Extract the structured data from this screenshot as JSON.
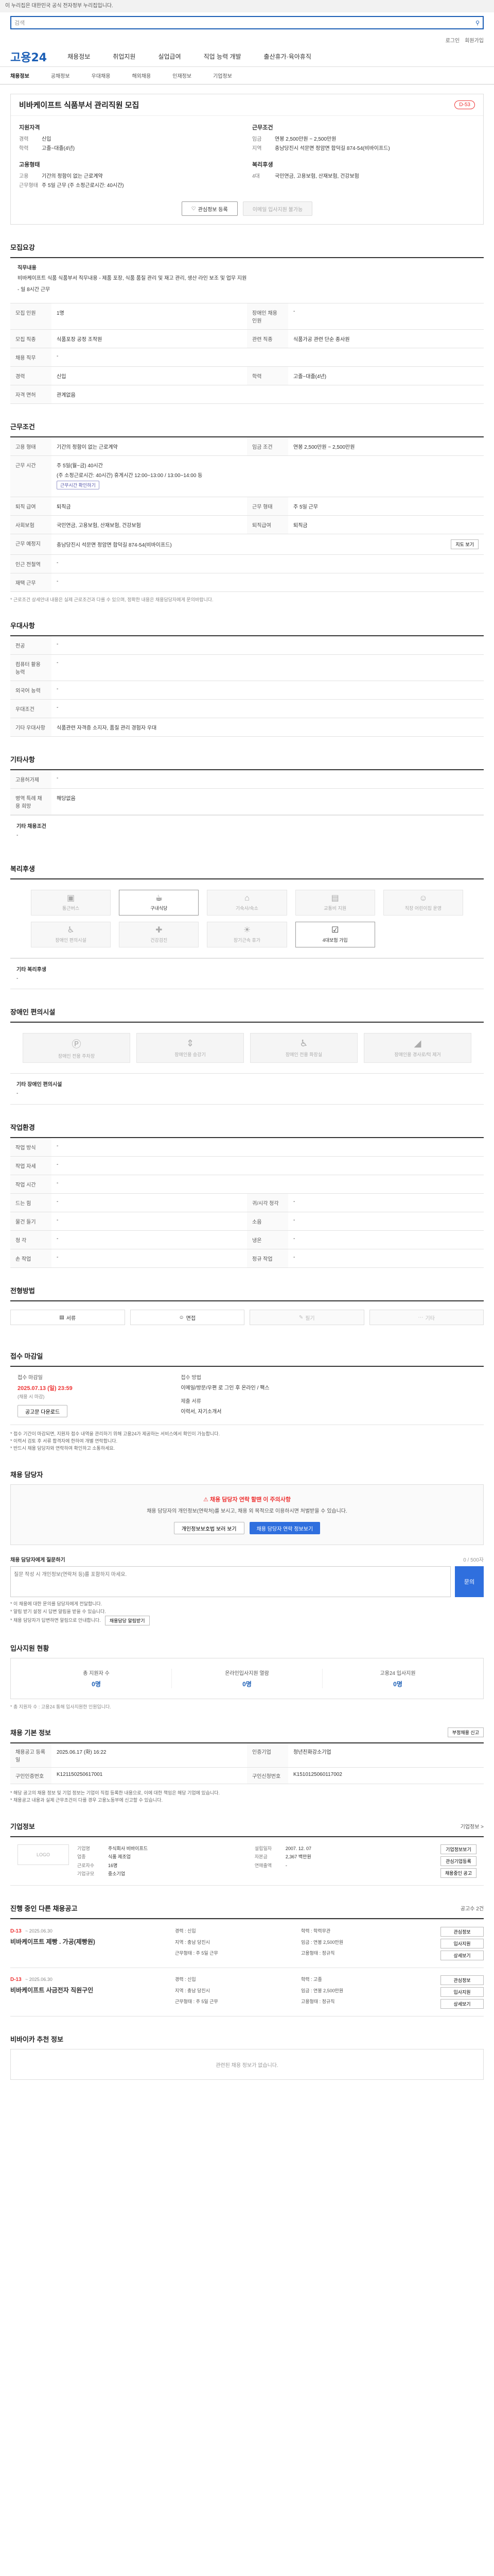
{
  "gov_bar": "이 누리집은 대한민국 공식 전자정부 누리집입니다.",
  "search": {
    "placeholder": "검색"
  },
  "util": [
    "로그인",
    "회원가입"
  ],
  "logo": "고용24",
  "gnb": [
    "채용정보",
    "취업지원",
    "실업급여",
    "직업 능력 개발",
    "출산휴가·육아휴직"
  ],
  "lnb": [
    "채용정보",
    "공채정보",
    "우대채용",
    "해외채용",
    "인재정보",
    "기업정보"
  ],
  "job": {
    "title": "비바케이프트 식품부서 관리직원 모집",
    "badge": "D-53",
    "company_label": "지원자격",
    "apply_label": "근무조건",
    "left": [
      {
        "k": "경력",
        "v": "신입"
      },
      {
        "k": "학력",
        "v": "고졸~대졸(4년)"
      }
    ],
    "right": [
      {
        "k": "임금",
        "v": "연봉 2,500만원 ~ 2,500만원"
      },
      {
        "k": "지역",
        "v": "충남당진시 석문면 정암면 합덕길 874-54(비바이프드)"
      }
    ],
    "left2_label": "고용형태",
    "left2": [
      {
        "k": "고용",
        "v": "기간의 정함이 없는 근로계약"
      },
      {
        "k": "근무형태",
        "v": "주 5일 근무 (주 소정근로시간: 40시간)"
      }
    ],
    "right2_label": "복리후생",
    "right2": [
      {
        "k": "4대",
        "v": "국민연금, 고용보험, 산재보험, 건강보험"
      }
    ],
    "btn_scrap": "관심정보 등록",
    "btn_apply": "이메일 입사지원 불가능"
  },
  "recruit": {
    "title": "모집요강",
    "desc_label": "직무내용",
    "desc": "비바케이프트 식품 식품부서 직무내용 - 제품 포장, 식품 품질 관리 및 재고 관리, 생산 라인 보조 및 업무 지원",
    "desc_extra": "- 일 8시간 근무",
    "rows": [
      {
        "k": "모집 인원",
        "v": "1명",
        "k2": "장애인 채용 인원",
        "v2": "-"
      },
      {
        "k": "모집 직종",
        "v": "식품포장 공정 조작원",
        "k2": "관련 직종",
        "v2": "식품가공 관련 단순 종사원"
      },
      {
        "k": "채용 직무",
        "v": "-",
        "k2": "",
        "v2": ""
      },
      {
        "k": "경력",
        "v": "신입",
        "k2": "학력",
        "v2": "고졸~대졸(4년)"
      },
      {
        "k": "자격 면허",
        "v": "관계없음",
        "k2": "",
        "v2": ""
      }
    ]
  },
  "conditions": {
    "title": "근무조건",
    "rows": [
      {
        "k": "고용 형태",
        "v": "기간의 정함이 없는 근로계약",
        "k2": "임금 조건",
        "v2": "연봉 2,500만원 ~ 2,500만원"
      },
      {
        "k": "",
        "v": "주 5일(월~금) 40시간",
        "k2": "",
        "v2": ""
      },
      {
        "k": "근무 시간",
        "v": "(주 소정근로시간: 40시간) 휴게시간 12:00~13:00 / 13:00~14:00 등",
        "k2": "",
        "v2": ""
      },
      {
        "k": "퇴직 급여",
        "v": "퇴직금",
        "k2": "근무 형태",
        "v2": "주 5일 근무"
      },
      {
        "k": "사회보험",
        "v": "국민연금, 고용보험, 산재보험, 건강보험",
        "k2": "퇴직급여",
        "v2": "퇴직금"
      },
      {
        "k": "근무 예정지",
        "v": "충남당진시 석문면 정암면 합덕길 874-54(비바이프드)",
        "k2": "",
        "v2": ""
      },
      {
        "k": "인근 전철역",
        "v": "-",
        "k2": "",
        "v2": ""
      },
      {
        "k": "재택 근무",
        "v": "-",
        "k2": "",
        "v2": ""
      }
    ],
    "map_btn": "지도 보기",
    "worktime_chip": "근무시간 확인하기",
    "note": "* 근로조건 상세안내 내용은 실제 근로조건과 다를 수 있으며, 정확한 내용은 채용담당자에게 문의바랍니다."
  },
  "preference": {
    "title": "우대사항",
    "rows": [
      {
        "k": "전공",
        "v": "-"
      },
      {
        "k": "컴퓨터 활용 능력",
        "v": "-"
      },
      {
        "k": "외국어 능력",
        "v": "-"
      },
      {
        "k": "우대조건",
        "v": "-"
      },
      {
        "k": "기타 우대사항",
        "v": "식품관련 자격증 소지자, 품질 관리 경험자 우대"
      }
    ]
  },
  "etc": {
    "title": "기타사항",
    "rows": [
      {
        "k": "고용허가제",
        "v": "-"
      },
      {
        "k": "병역 특례 채용 희망",
        "v": "해당없음"
      }
    ],
    "extra_label": "기타 채용조건",
    "extra_value": "-"
  },
  "welfare": {
    "title": "복리후생",
    "items": [
      {
        "icon": "home-icon",
        "label": "통근버스",
        "on": false
      },
      {
        "icon": "meal-icon",
        "label": "구내식당",
        "on": true
      },
      {
        "icon": "dorm-icon",
        "label": "기숙사/숙소",
        "on": false
      },
      {
        "icon": "car-icon",
        "label": "교통비 지원",
        "on": false
      },
      {
        "icon": "childcare-icon",
        "label": "직장 어린이집 운영",
        "on": false
      },
      {
        "icon": "support-icon",
        "label": "장애인 편의시설",
        "on": false
      },
      {
        "icon": "health-icon",
        "label": "건강검진",
        "on": false
      },
      {
        "icon": "vacation-icon",
        "label": "장기근속 휴가",
        "on": false
      },
      {
        "icon": "insurance-icon",
        "label": "4대보험 가입",
        "on": true
      }
    ],
    "extra_label": "기타 복리후생",
    "extra_value": "-"
  },
  "disability": {
    "title": "장애인 편의시설",
    "items": [
      "장애인 전용 주차장",
      "장애인용 승강기",
      "장애인 전용 화장실",
      "장애인용 경사로/턱 제거"
    ],
    "extra_label": "기타 장애인 편의시설",
    "extra_value": "-"
  },
  "work_env": {
    "title": "작업환경",
    "rows": [
      {
        "k": "작업 방식",
        "v": "-",
        "k2": "",
        "v2": ""
      },
      {
        "k": "작업 자세",
        "v": "-",
        "k2": "",
        "v2": ""
      },
      {
        "k": "작업 시간",
        "v": "-",
        "k2": "",
        "v2": ""
      },
      {
        "k": "드는 힘",
        "v": "-",
        "k2": "귀/시각 청각",
        "v2": "-"
      },
      {
        "k": "물건 들기",
        "v": "-",
        "k2": "소음",
        "v2": "-"
      },
      {
        "k": "청 각",
        "v": "-",
        "k2": "냉온",
        "v2": "-"
      },
      {
        "k": "손 작업",
        "v": "-",
        "k2": "정규 작업",
        "v2": "-"
      }
    ]
  },
  "method": {
    "title": "전형방법",
    "items": [
      {
        "icon": "doc-icon",
        "label": "서류",
        "off": false
      },
      {
        "icon": "interview-icon",
        "label": "면접",
        "off": false
      },
      {
        "icon": "test-icon",
        "label": "필기",
        "off": true
      },
      {
        "icon": "etc-icon",
        "label": "기타",
        "off": true
      }
    ]
  },
  "apply": {
    "title": "접수 마감일",
    "deadline_label": "접수 마감일",
    "deadline": "2025.07.13 (일) 23:59",
    "deadline_note": "(채용 시 마감)",
    "posting_btn": "공고문 다운로드",
    "method_label": "접수 방법",
    "method": "이메일/방문/우편 로 그인 후 온라인 / 팩스",
    "doc_label": "제출 서류",
    "doc": "이력서, 자기소개서",
    "notes": [
      "* 접수 기간이 마감되면, 지원자 접수 내역을 관리하기 위해 고용24가 제공하는 서비스에서 확인이 가능합니다.",
      "* 이력서 검토 후 서류 합격자에 한하여 개별 연락합니다.",
      "* 반드시 채용 담당자와 연락하여 확인하고 소통하세요."
    ]
  },
  "contact": {
    "title": "채용 담당자",
    "warn_title": "채용 담당자 연락 할땐 이 주의사항",
    "warn_text": "채용 담당자의 개인정보(연락처)를 보시고, 채용 외 목적으로 이용하시면 처벌받을 수 있습니다.",
    "btn_person": "개인정보보호법 보러 보기",
    "btn_contact": "채용 담당자 연락 정보보기",
    "inquiry_label": "채용 담당자에게 질문하기",
    "inquiry_count": "0 / 500자",
    "inquiry_placeholder": "질문 작성 시 개인정보(연락처 등)를 포함하지 마세요.",
    "send": "문의",
    "inq_notes": [
      "* 이 채용에 대한 문의를 담당자에게 전달합니다.",
      "* 알림 받기 설정 시 답변 알림을 받을 수 있습니다.",
      "* 채용 담당자가 답변하면 알림으로 안내합니다."
    ],
    "notify_btn": "채용담당 알림받기"
  },
  "status": {
    "title": "입사지원 현황",
    "items": [
      {
        "k": "총 지원자 수",
        "v": "0명"
      },
      {
        "k": "온라인입사지원 열람",
        "v": "0명"
      },
      {
        "k": "고용24 입사지원",
        "v": "0명"
      }
    ],
    "note": "* 총 지원자 수 : 고용24 통해 입사지원한 인원입니다."
  },
  "info": {
    "title": "채용 기본 정보",
    "rows": [
      {
        "k": "채용공고 등록일",
        "v": "2025.06.17 (화) 16:22",
        "k2": "인증기업",
        "v2": "청년친화강소기업"
      },
      {
        "k": "구인인증번호",
        "v": "K121150250617001",
        "k2": "구인신청번호",
        "v2": "K1510125060117002"
      }
    ],
    "report_btn": "부정채용 신고",
    "notes": [
      "* 해당 공고의 채용 정보 및 기업 정보는 기업이 직접 등록한 내용으로, 이에 대한 책임은 해당 기업에 있습니다.",
      "* 채용공고 내용과 실제 근무조건이 다를 경우 고용노동부에 신고할 수 있습니다."
    ]
  },
  "company": {
    "title": "기업정보",
    "detail_btn": "기업정보 >",
    "logo_text": "LOGO",
    "rows": [
      {
        "k": "기업명",
        "v": "주식회사 비바이프드",
        "k2": "설립일자",
        "v2": "2007. 12. 07"
      },
      {
        "k": "업종",
        "v": "식품 제조업",
        "k2": "자본금",
        "v2": "2,367 백만원"
      },
      {
        "k": "근로자수",
        "v": "16명",
        "k2": "연매출액",
        "v2": "-"
      },
      {
        "k": "기업규모",
        "v": "중소기업",
        "k2": "",
        "v2": ""
      }
    ],
    "btns": [
      "기업정보보기",
      "관심기업등록",
      "채용중인 공고"
    ]
  },
  "others": {
    "title": "진행 중인 다른 채용공고",
    "count": "공고수 2건",
    "items": [
      {
        "dday": "D-13",
        "date": "~ 2025.06.30",
        "title": "비바케이프트 제빵 . 가공(제빵원)",
        "info": [
          "경력 : 신입",
          "학력 : 학력무관",
          "지역 : 충남 당진시",
          "임금 : 연봉 2,500만원",
          "근무형태 : 주 5일 근무",
          "고용형태 : 정규직"
        ],
        "btns": [
          "관심정보",
          "입사지원",
          "상세보기"
        ]
      },
      {
        "dday": "D-13",
        "date": "~ 2025.06.30",
        "title": "비바케이프트 사금전자 직원구인",
        "info": [
          "경력 : 신입",
          "학력 : 고졸",
          "지역 : 충남 당진시",
          "임금 : 연봉 2,500만원",
          "근무형태 : 주 5일 근무",
          "고용형태 : 정규직"
        ],
        "btns": [
          "관심정보",
          "입사지원",
          "상세보기"
        ]
      }
    ]
  },
  "similar": {
    "title": "비바이카 추천 정보",
    "empty": "관련된 채용 정보가 없습니다."
  }
}
